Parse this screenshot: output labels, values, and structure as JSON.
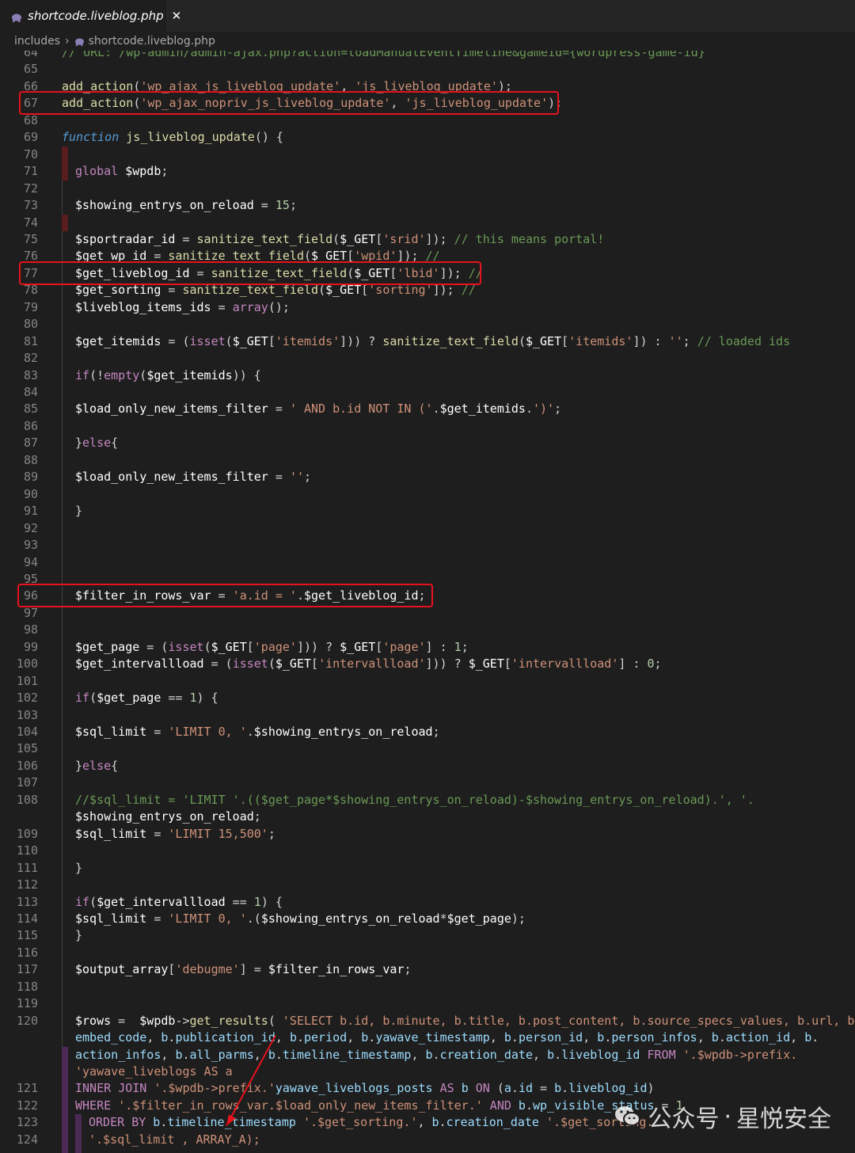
{
  "tab": {
    "label": "shortcode.liveblog.php",
    "close": "✕"
  },
  "breadcrumb": {
    "folder": "includes",
    "separator": "›",
    "file": "shortcode.liveblog.php"
  },
  "watermark": {
    "platform": "公众号",
    "dot": "·",
    "name": "星悦安全"
  },
  "colors": {
    "highlight_box": "#e8121e",
    "keyword": "#c586c0",
    "function_keyword": "#569cd6",
    "string": "#ce9178",
    "comment": "#6a9955",
    "variable": "#ffffff",
    "function_call": "#dcdcaa"
  },
  "icons": {
    "tab_icon": "php-elephant-icon",
    "breadcrumb_icon": "php-elephant-icon",
    "watermark_icon": "wechat-icon"
  },
  "lines": [
    {
      "num": "64",
      "code": "// URL: /wp-admin/admin-ajax.php?action=loadManualEventTimeline&gameid={wordpress-game-id}"
    },
    {
      "num": "65",
      "code": ""
    },
    {
      "num": "66",
      "code": "add_action('wp_ajax_js_liveblog_update', 'js_liveblog_update');"
    },
    {
      "num": "67",
      "code": "add_action('wp_ajax_nopriv_js_liveblog_update', 'js_liveblog_update');"
    },
    {
      "num": "68",
      "code": ""
    },
    {
      "num": "69",
      "code": "function js_liveblog_update() {"
    },
    {
      "num": "70",
      "code": ""
    },
    {
      "num": "71",
      "code": "global $wpdb;"
    },
    {
      "num": "72",
      "code": ""
    },
    {
      "num": "73",
      "code": "$showing_entrys_on_reload = 15;"
    },
    {
      "num": "74",
      "code": ""
    },
    {
      "num": "75",
      "code": "$sportradar_id = sanitize_text_field($_GET['srid']); // this means portal!"
    },
    {
      "num": "76",
      "code": "$get_wp_id = sanitize_text_field($_GET['wpid']); //"
    },
    {
      "num": "77",
      "code": "$get_liveblog_id = sanitize_text_field($_GET['lbid']); //"
    },
    {
      "num": "78",
      "code": "$get_sorting = sanitize_text_field($_GET['sorting']); //"
    },
    {
      "num": "79",
      "code": "$liveblog_items_ids = array();"
    },
    {
      "num": "80",
      "code": ""
    },
    {
      "num": "81",
      "code": "$get_itemids = (isset($_GET['itemids'])) ? sanitize_text_field($_GET['itemids']) : ''; // loaded ids"
    },
    {
      "num": "82",
      "code": ""
    },
    {
      "num": "83",
      "code": "if(!empty($get_itemids)) {"
    },
    {
      "num": "84",
      "code": ""
    },
    {
      "num": "85",
      "code": "$load_only_new_items_filter = ' AND b.id NOT IN ('.$get_itemids.')';"
    },
    {
      "num": "86",
      "code": ""
    },
    {
      "num": "87",
      "code": "}else{"
    },
    {
      "num": "88",
      "code": ""
    },
    {
      "num": "89",
      "code": "$load_only_new_items_filter = '';"
    },
    {
      "num": "90",
      "code": ""
    },
    {
      "num": "91",
      "code": "}"
    },
    {
      "num": "92",
      "code": ""
    },
    {
      "num": "93",
      "code": ""
    },
    {
      "num": "94",
      "code": ""
    },
    {
      "num": "95",
      "code": ""
    },
    {
      "num": "96",
      "code": "$filter_in_rows_var = 'a.id = '.$get_liveblog_id;"
    },
    {
      "num": "97",
      "code": ""
    },
    {
      "num": "98",
      "code": ""
    },
    {
      "num": "99",
      "code": "$get_page = (isset($_GET['page'])) ? $_GET['page'] : 1;"
    },
    {
      "num": "100",
      "code": "$get_intervallload = (isset($_GET['intervallload'])) ? $_GET['intervallload'] : 0;"
    },
    {
      "num": "101",
      "code": ""
    },
    {
      "num": "102",
      "code": "if($get_page == 1) {"
    },
    {
      "num": "103",
      "code": ""
    },
    {
      "num": "104",
      "code": "$sql_limit = 'LIMIT 0, '.$showing_entrys_on_reload;"
    },
    {
      "num": "105",
      "code": ""
    },
    {
      "num": "106",
      "code": "}else{"
    },
    {
      "num": "107",
      "code": ""
    },
    {
      "num": "108",
      "code": "//$sql_limit = 'LIMIT '.(($get_page*$showing_entrys_on_reload)-$showing_entrys_on_reload).', '."
    },
    {
      "num": "",
      "code": "$showing_entrys_on_reload;"
    },
    {
      "num": "109",
      "code": "$sql_limit = 'LIMIT 15,500';"
    },
    {
      "num": "110",
      "code": ""
    },
    {
      "num": "111",
      "code": "}"
    },
    {
      "num": "112",
      "code": ""
    },
    {
      "num": "113",
      "code": "if($get_intervallload == 1) {"
    },
    {
      "num": "114",
      "code": "$sql_limit = 'LIMIT 0, '.($showing_entrys_on_reload*$get_page);"
    },
    {
      "num": "115",
      "code": "}"
    },
    {
      "num": "116",
      "code": ""
    },
    {
      "num": "117",
      "code": "$output_array['debugme'] = $filter_in_rows_var;"
    },
    {
      "num": "118",
      "code": ""
    },
    {
      "num": "119",
      "code": ""
    },
    {
      "num": "120",
      "code": "$rows =  $wpdb->get_results( 'SELECT b.id, b.minute, b.title, b.post_content, b.source_specs_values, b.url, b."
    },
    {
      "num": "",
      "code": "embed_code, b.publication_id, b.period, b.yawave_timestamp, b.person_id, b.person_infos, b.action_id, b."
    },
    {
      "num": "",
      "code": "action_infos, b.all_parms, b.timeline_timestamp, b.creation_date, b.liveblog_id FROM '.$wpdb->prefix."
    },
    {
      "num": "",
      "code": "'yawave_liveblogs AS a"
    },
    {
      "num": "121",
      "code": "INNER JOIN '.$wpdb->prefix.'yawave_liveblogs_posts AS b ON (a.id = b.liveblog_id)"
    },
    {
      "num": "122",
      "code": "WHERE '.$filter_in_rows_var.$load_only_new_items_filter.' AND b.wp_visible_status = 1"
    },
    {
      "num": "123",
      "code": "ORDER BY b.timeline_timestamp '.$get_sorting.', b.creation_date '.$get_sorting."
    },
    {
      "num": "124",
      "code": "'.$sql_limit , ARRAY_A);"
    }
  ]
}
